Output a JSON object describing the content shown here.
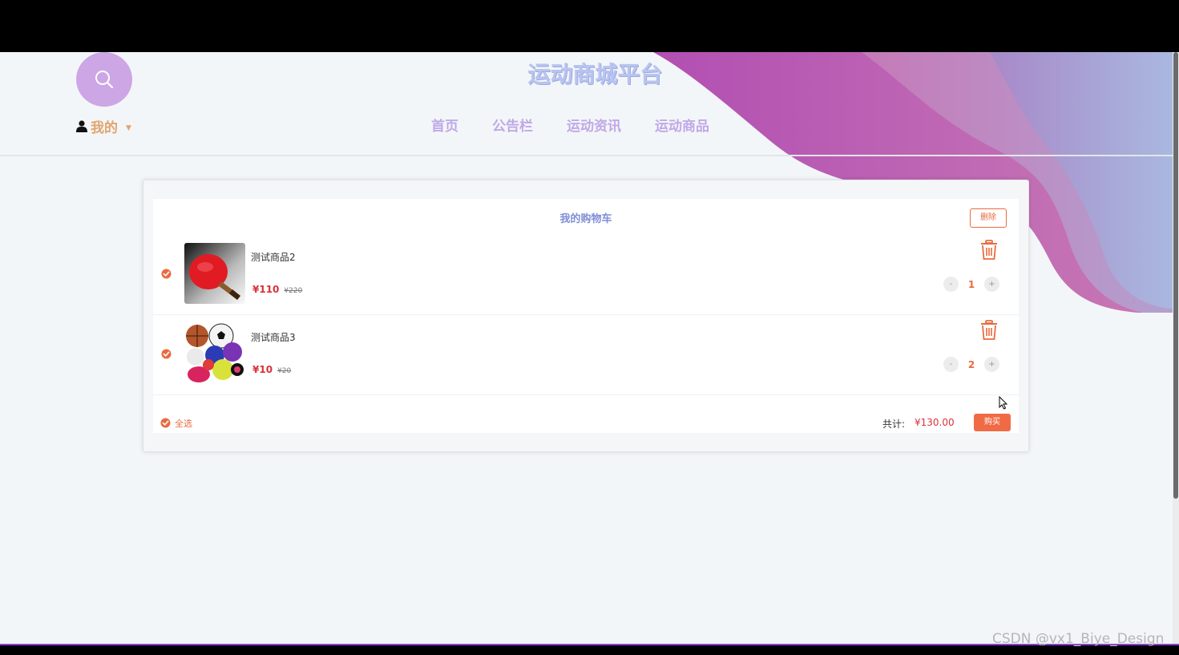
{
  "header": {
    "site_title": "运动商城平台",
    "user_menu_label": "我的",
    "nav": [
      "首页",
      "公告栏",
      "运动资讯",
      "运动商品"
    ]
  },
  "cart": {
    "title": "我的购物车",
    "delete_label": "删除",
    "items": [
      {
        "name": "测试商品2",
        "price": "¥110",
        "original_price": "¥220",
        "quantity": "1",
        "image_icon": "table-tennis-paddle"
      },
      {
        "name": "测试商品3",
        "price": "¥10",
        "original_price": "¥20",
        "quantity": "2",
        "image_icon": "assorted-sports-balls"
      }
    ],
    "select_all_label": "全选",
    "total_label": "共计:",
    "total_value": "¥130.00",
    "buy_label": "购买",
    "decrement_symbol": "-",
    "increment_symbol": "+"
  },
  "watermark": "CSDN @vx1_Biye_Design",
  "colors": {
    "accent": "#e96b3f",
    "price_red": "#d9323a",
    "title_blue": "#7f8fd6",
    "nav_purple": "#c0a8e8",
    "search_circle": "#cda6e6"
  }
}
